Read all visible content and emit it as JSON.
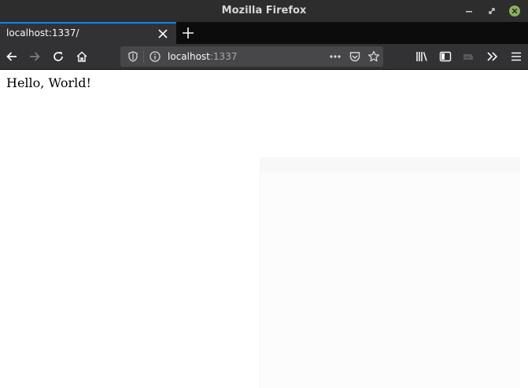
{
  "window": {
    "title": "Mozilla Firefox",
    "controls": [
      "minimize-icon",
      "restore-icon",
      "close-icon"
    ]
  },
  "tabs": [
    {
      "title": "localhost:1337/",
      "active": true
    }
  ],
  "toolbar": {
    "back": "back-arrow-icon",
    "forward": "forward-arrow-icon",
    "reload": "reload-icon",
    "home": "home-icon",
    "library": "library-icon",
    "sidebar": "sidebar-icon",
    "screenshot": "screenshot-icon",
    "overflow": "chevron-double-right-icon",
    "menu": "hamburger-menu-icon"
  },
  "urlbar": {
    "host": "localhost",
    "port": ":1337",
    "icons": [
      "shield-icon",
      "info-icon",
      "more-dots-icon",
      "pocket-icon",
      "bookmark-star-icon"
    ]
  },
  "page": {
    "text": "Hello, World!"
  },
  "colors": {
    "tab_accent": "#0a84ff",
    "chrome_dark": "#0c0c0d",
    "toolbar": "#323234",
    "urlbar": "#474749",
    "close_button": "#8ab35a"
  }
}
